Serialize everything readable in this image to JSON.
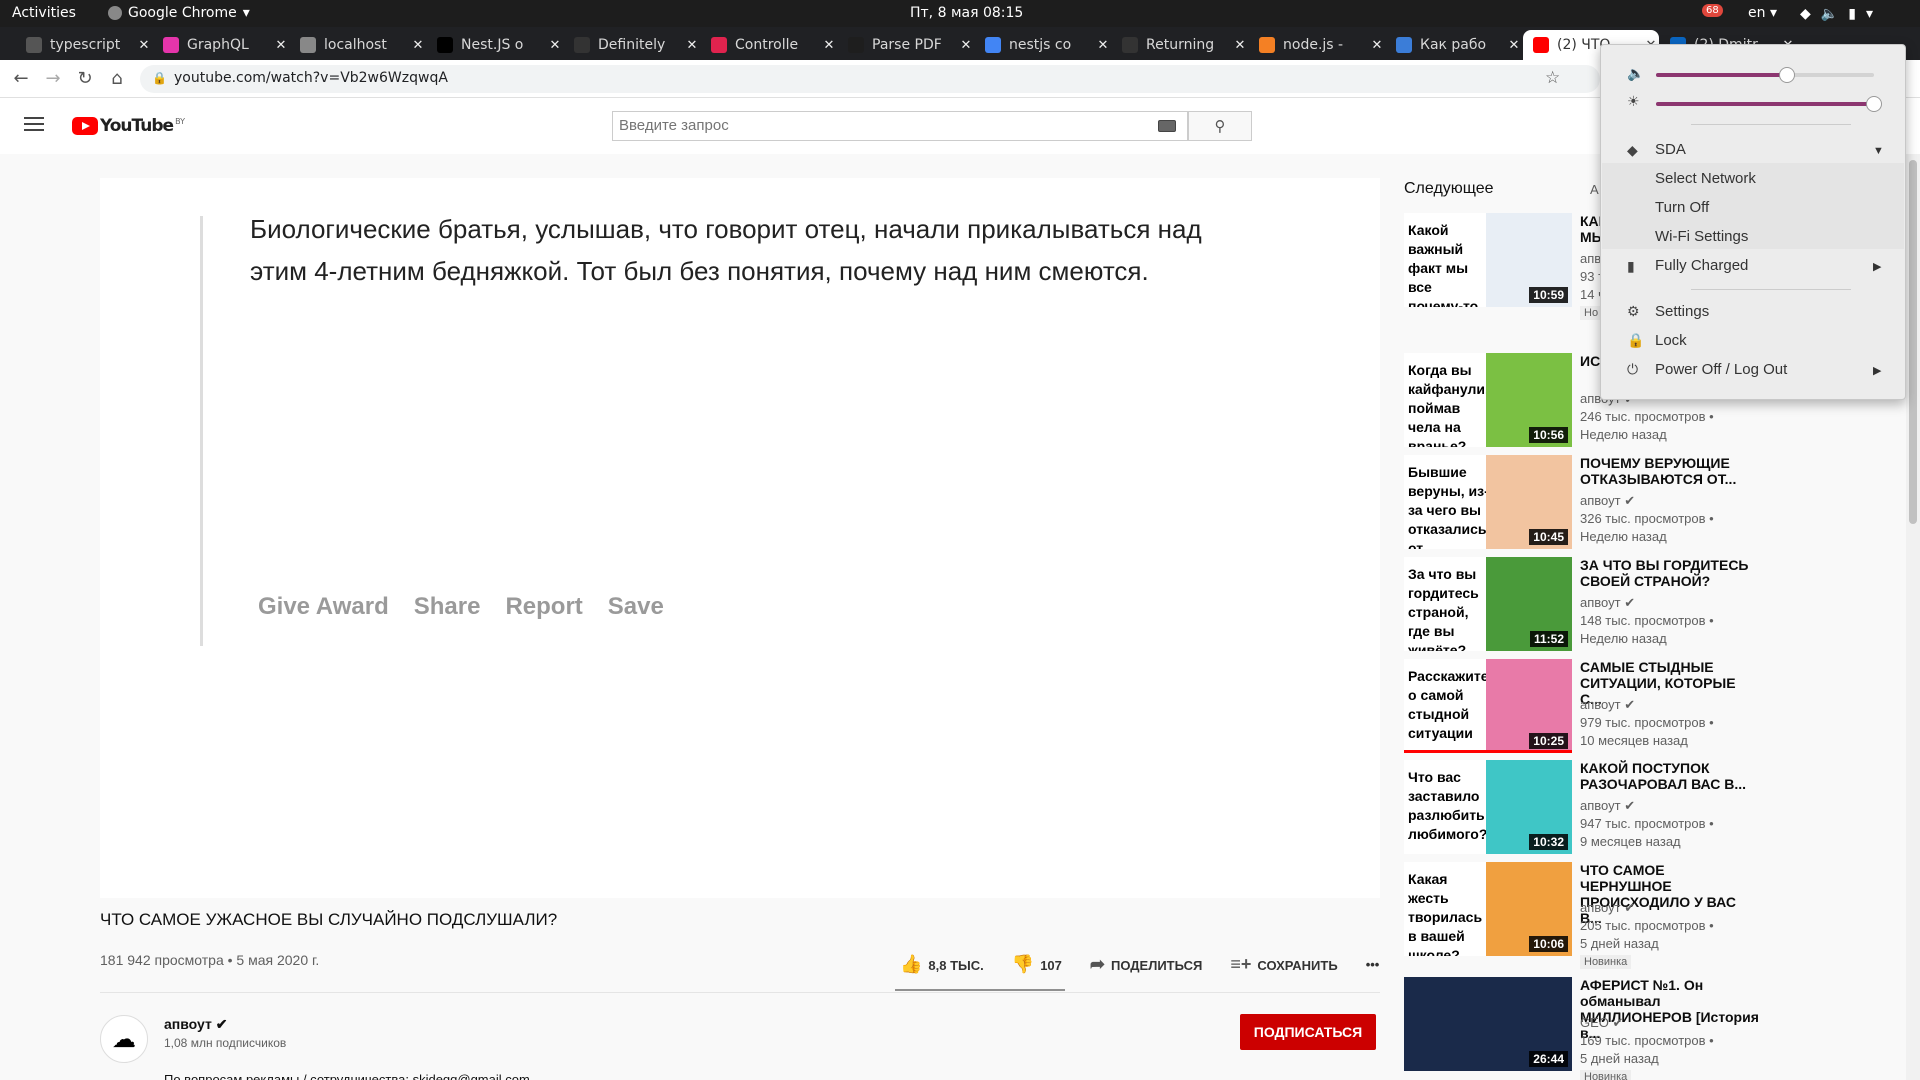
{
  "topbar": {
    "activities": "Activities",
    "app": "Google Chrome",
    "clock": "Пт, 8 мая  08:15",
    "badge": "68",
    "lang": "en"
  },
  "tabs": [
    {
      "label": "typescript",
      "color": "#555555"
    },
    {
      "label": "GraphQL",
      "color": "#e535ab"
    },
    {
      "label": "localhost",
      "color": "#888888"
    },
    {
      "label": "Nest.JS o",
      "color": "#000000"
    },
    {
      "label": "Definitely",
      "color": "#333333"
    },
    {
      "label": "Controlle",
      "color": "#e0234e"
    },
    {
      "label": "Parse PDF",
      "color": "#1e1e1e"
    },
    {
      "label": "nestjs co",
      "color": "#4285f4"
    },
    {
      "label": "Returning",
      "color": "#333333"
    },
    {
      "label": "node.js -",
      "color": "#f48024"
    },
    {
      "label": "Как рабо",
      "color": "#3b7dd8"
    },
    {
      "label": "(2) ЧТО",
      "color": "#ff0000"
    },
    {
      "label": "(2) Dmitr",
      "color": "#0a66c2"
    }
  ],
  "address": {
    "url": "youtube.com/watch?v=Vb2w6WzqwqA"
  },
  "yt": {
    "logo_text": "YouTube",
    "region": "BY",
    "search_placeholder": "Введите запрос"
  },
  "player": {
    "quote": "Биологические братья, услышав, что говорит отец, начали прикалываться над этим 4-летним бедняжкой. Тот был без понятия, почему над ним смеются.",
    "actions": [
      "Give Award",
      "Share",
      "Report",
      "Save"
    ]
  },
  "video": {
    "title": "ЧТО САМОЕ УЖАСНОЕ ВЫ СЛУЧАЙНО ПОДСЛУШАЛИ?",
    "meta": "181 942 просмотра • 5 мая 2020 г.",
    "likes": "8,8 ТЫС.",
    "dislikes": "107",
    "share": "ПОДЕЛИТЬСЯ",
    "save": "СОХРАНИТЬ",
    "more": "•••"
  },
  "channel": {
    "name": "апвоут",
    "subs": "1,08 млн подписчиков",
    "desc": "По вопросам рекламы / сотрудничества: skideqq@gmail.com",
    "subscribe": "ПОДПИСАТЬСЯ"
  },
  "sidebar": {
    "upnext": "Следующее",
    "autoplay": "А",
    "items": [
      {
        "thumb": "Какой важный факт мы все почему-то игнорируем?",
        "dur": "10:59",
        "title": "КАКОЙ ВАЖНЫЙ ФАКТ МЫ ВСЕ...",
        "chan": "апвоут",
        "views": "93 тыс. просмотров",
        "age": "14 ч",
        "new": "Но",
        "bg": "#e8eef5"
      },
      {
        "thumb": "Когда вы кайфанули, поймав чела на вранье?",
        "dur": "10:56",
        "title": "ИСТОРИИ ЧЕЛОВЕКА...",
        "chan": "апвоут",
        "views": "246 тыс. просмотров •",
        "age": "Неделю назад",
        "new": "",
        "bg": "#7bc043"
      },
      {
        "thumb": "Бывшие веруны, из-за чего вы отказались от религии?",
        "dur": "10:45",
        "title": "ПОЧЕМУ ВЕРУЮЩИЕ ОТКАЗЫВАЮТСЯ ОТ...",
        "chan": "апвоут",
        "views": "326 тыс. просмотров •",
        "age": "Неделю назад",
        "new": "",
        "bg": "#f2c4a0"
      },
      {
        "thumb": "За что вы гордитесь страной, где вы живёте?",
        "dur": "11:52",
        "title": "ЗА ЧТО ВЫ ГОРДИТЕСЬ СВОЕЙ СТРАНОЙ?",
        "chan": "апвоут",
        "views": "148 тыс. просмотров •",
        "age": "Неделю назад",
        "new": "",
        "bg": "#4a9a3a"
      },
      {
        "thumb": "Расскажите о самой стыдной ситуации",
        "dur": "10:25",
        "title": "САМЫЕ СТЫДНЫЕ СИТУАЦИИ, КОТОРЫЕ С...",
        "chan": "апвоут",
        "views": "979 тыс. просмотров •",
        "age": "10 месяцев назад",
        "new": "",
        "bg": "#e87aa8"
      },
      {
        "thumb": "Что вас заставило разлюбить любимого?",
        "dur": "10:32",
        "title": "КАКОЙ ПОСТУПОК РАЗОЧАРОВАЛ ВАС В...",
        "chan": "апвоут",
        "views": "947 тыс. просмотров •",
        "age": "9 месяцев назад",
        "new": "",
        "bg": "#3fc6c6"
      },
      {
        "thumb": "Какая жесть творилась в вашей школе?",
        "dur": "10:06",
        "title": "ЧТО САМОЕ ЧЕРНУШНОЕ ПРОИСХОДИЛО У ВАС В...",
        "chan": "апвоут",
        "views": "205 тыс. просмотров •",
        "age": "5 дней назад",
        "new": "Новинка",
        "bg": "#f0a040"
      },
      {
        "thumb": "",
        "dur": "26:44",
        "title": "АФЕРИСТ №1. Он обманывал МИЛЛИОНЕРОВ [История в...",
        "chan": "GEO",
        "views": "169 тыс. просмотров •",
        "age": "5 дней назад",
        "new": "Новинка",
        "bg": "#1a2a4a"
      }
    ]
  },
  "sysmenu": {
    "volume": 0.6,
    "brightness": 1.0,
    "network": "SDA",
    "net_items": [
      "Select Network",
      "Turn Off",
      "Wi-Fi Settings"
    ],
    "battery": "Fully Charged",
    "settings": "Settings",
    "lock": "Lock",
    "power": "Power Off / Log Out"
  }
}
